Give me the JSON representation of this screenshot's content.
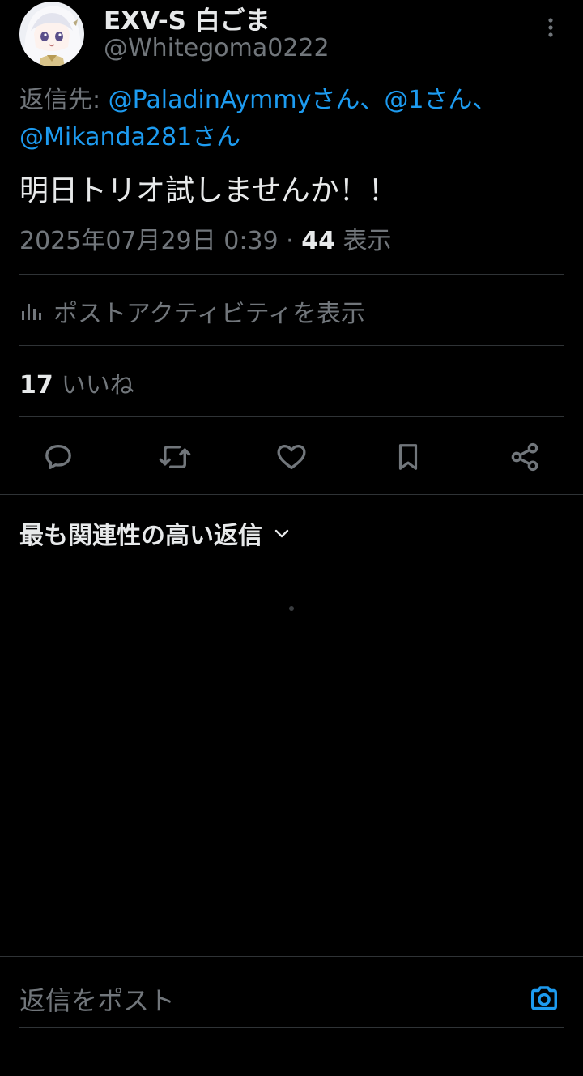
{
  "author": {
    "display_name": "EXV-S 白ごま",
    "handle": "@Whitegoma0222"
  },
  "reply_to": {
    "prefix": "返信先: ",
    "mentions": [
      "@PaladinAymmyさん",
      "@1さん",
      "@Mikanda281さん"
    ],
    "separator": "、"
  },
  "tweet": {
    "text": "明日トリオ試しませんか！！",
    "datetime": "2025年07月29日 0:39",
    "dot": " · ",
    "views_count": "44",
    "views_label": " 表示"
  },
  "activity": {
    "label": "ポストアクティビティを表示",
    "icon": "bar-chart-icon"
  },
  "likes": {
    "count": "17",
    "label": "いいね"
  },
  "actions": [
    {
      "name": "reply",
      "icon": "reply-icon"
    },
    {
      "name": "repost",
      "icon": "repost-icon"
    },
    {
      "name": "like",
      "icon": "heart-icon"
    },
    {
      "name": "bookmark",
      "icon": "bookmark-icon"
    },
    {
      "name": "share",
      "icon": "share-icon"
    }
  ],
  "replies_sort": {
    "label": "最も関連性の高い返信",
    "icon": "chevron-down-icon"
  },
  "composer": {
    "placeholder": "返信をポスト",
    "camera_icon": "camera-icon"
  },
  "colors": {
    "background": "#000000",
    "text": "#e7e9ea",
    "secondary_text": "#71767b",
    "accent": "#1d9bf0",
    "divider": "#2f3336"
  }
}
